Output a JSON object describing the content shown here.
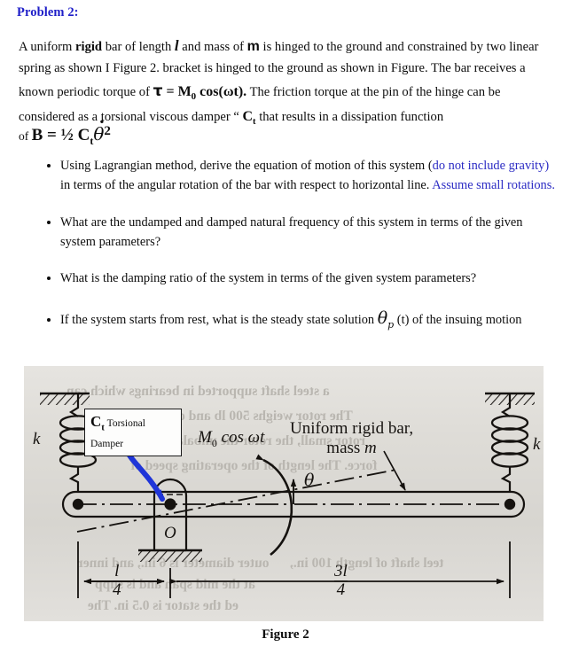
{
  "heading": {
    "text": "Problem 2:",
    "color": "#1e1ec8"
  },
  "paragraph": {
    "s1": "A uniform ",
    "s2": "rigid",
    "s3": " bar of length ",
    "sym_l": "l",
    "s4": " and mass of ",
    "sym_m": "m",
    "s5": " is hinged to the ground and constrained by two linear spring as shown I Figure 2. bracket is hinged to the ground as shown in Figure.  The bar receives a known periodic torque of ",
    "sym_tau": "τ",
    "s6": " = ",
    "sym_M": "M",
    "sym_M_sub": "0",
    "s7": " cos(ωt).",
    "s8": "  The friction torque at the pin of the hinge can be considered as a torsional viscous damper “ ",
    "sym_Ct": "C",
    "sym_Ct_sub": "t",
    "s9": " that results in a  dissipation function",
    "eq_lead": "of ",
    "eq_B": "B = ½ ",
    "eq_Ct": "C",
    "eq_Ct_sub": "t",
    "eq_theta": "θ",
    "eq_dot": "•",
    "eq_pow": "2"
  },
  "questions": [
    {
      "black_1": "Using Lagrangian method, derive the equation of motion of this system (",
      "blue_1": "do not include gravity)",
      "black_2": " in terms of the angular rotation of the bar with respect to horizontal line. ",
      "blue_2": "Assume small rotations."
    },
    {
      "black_1": "What are the undamped and damped natural frequency of this system in terms of the given system parameters?"
    },
    {
      "black_1": "What is the damping ratio of the system in terms of the given system parameters?"
    },
    {
      "black_1": "If the system starts from rest, what is the steady state solution ",
      "theta": "θ",
      "theta_sub": "p",
      "black_2": " (t) of the insuing motion"
    }
  ],
  "figure": {
    "caption": "Figure 2",
    "labels": {
      "k_left": "k",
      "k_right": "k",
      "moment": "M",
      "moment_sub": "0",
      "moment_rest": " cos ωt",
      "theta": "θ",
      "pivot": "O",
      "bar_line1": "Uniform rigid bar,",
      "bar_line2a": "mass ",
      "bar_line2b": "m",
      "dim_left_num": "l",
      "dim_left_den": "4",
      "dim_right_num": "3l",
      "dim_right_den": "4"
    },
    "damper_box": {
      "c": "C",
      "c_sub": "t",
      "title": " Torsional",
      "sub": "Damper"
    },
    "ghost_text": [
      "a steel shaft supported in bearings which can",
      "The rotor weighs 500 lb and deliv",
      "rotor small, the rotor the unbalance in the ro",
      "force. The length of the operating speed of",
      "outer diameter is 6 in., and inner",
      "at the mid span and is supp",
      "ed the stator is 0.5 in. The",
      "teel shaft of length 100 in.,"
    ],
    "accent_arrow_color": "#1f35d8"
  }
}
